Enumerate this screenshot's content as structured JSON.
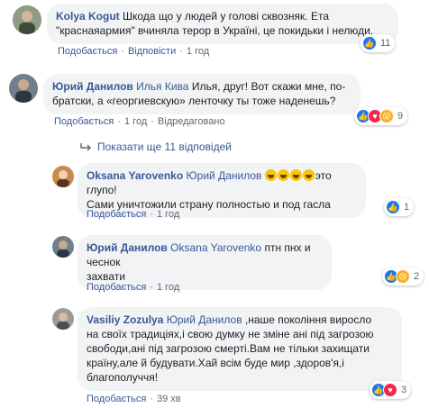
{
  "comments": [
    {
      "id": "kolya",
      "author": "Kolya Kogut",
      "text": "Шкода що у людей у голові сквозняк. Ета \"красная армия\" вчиняла терор в Україні, це покидьки і нелюди.",
      "line1": "Шкода що у людей у голові сквозняк. Ета",
      "line2": "\"краснаяармия\" вчиняла терор в Україні, це покидьки і нелюди.",
      "like_label": "Подобається",
      "reply_label": "Відповісти",
      "time": "1 год",
      "reaction_count": "11"
    },
    {
      "id": "yuri1",
      "author": "Юрий Данилов",
      "mention": "Илья Кива",
      "line1": "Илья, друг! Вот скажи мне, по-",
      "line2": "братски, а «георгиевскую» ленточку ты тоже наденешь?",
      "like_label": "Подобається",
      "time": "1 год",
      "edited_label": "Відредаговано",
      "reaction_count": "9"
    }
  ],
  "more_replies_label": "Показати ще 11 відповідей",
  "replies": [
    {
      "id": "oksana",
      "author": "Oksana Yarovenko",
      "mention": "Юрий Данилов",
      "line1_tail": "это глупо!",
      "line2": "Сами уничтожили страну полностью и под гасла",
      "like_label": "Подобається",
      "time": "1 год",
      "reaction_count": "1"
    },
    {
      "id": "yuri2",
      "author": "Юрий Данилов",
      "mention": "Oksana Yarovenko",
      "line1_tail": "птн пнх и чеснок",
      "line2": "захвати",
      "like_label": "Подобається",
      "time": "1 год",
      "reaction_count": "2"
    },
    {
      "id": "vasiliy",
      "author": "Vasiliy Zozulya",
      "mention": "Юрий Данилов",
      "line1_tail": ",наше покоління виросло",
      "line2": "на своїх традиціях,і свою думку не зміне ані під загрозою",
      "line3": "свободи,ані під загрозою смерті.Вам не тільки захищати",
      "line4": "країну,але й будувати.Хай всім буде мир ,здоров'я,і",
      "line5": "благополуччя!",
      "like_label": "Подобається",
      "time": "39 хв",
      "reaction_count": "3"
    }
  ],
  "colors": {
    "link": "#385898",
    "bubble": "#f2f3f5",
    "like": "#1877f2",
    "love": "#f0284a",
    "haha": "#f7b125"
  }
}
